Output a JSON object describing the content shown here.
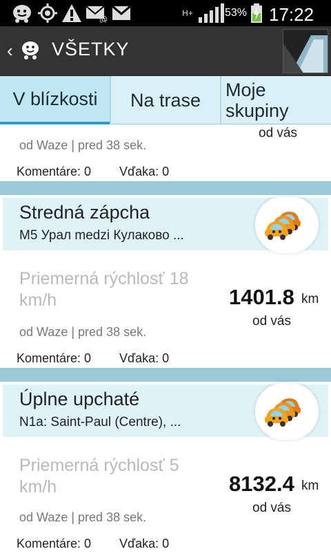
{
  "status_bar": {
    "battery_percent": "53%",
    "time": "17:22",
    "network": "H+",
    "icons": [
      "waze-notification-icon",
      "gps-icon",
      "warning-icon",
      "email-icon",
      "gmail-icon",
      "signal-icon",
      "battery-charging-icon"
    ]
  },
  "app_bar": {
    "title": "VŠETKY",
    "back_icon": "back-chevron-icon",
    "logo_icon": "waze-logo-icon"
  },
  "tabs": [
    {
      "label": "V blízkosti",
      "active": true
    },
    {
      "label": "Na trase",
      "active": false
    },
    {
      "label": "Moje skupiny",
      "active": false
    }
  ],
  "partial_card": {
    "distance_label": "od vás",
    "source": "od Waze | pred 38 sek.",
    "comments": "Komentáre: 0",
    "thanks": "Vďaka: 0"
  },
  "reports": [
    {
      "type": "Stredná zápcha",
      "street": "M5 Урал medzi Кулаково ...",
      "speed": "Priemerná rýchlosť 18 km/h",
      "distance": "1401.8",
      "unit": "km",
      "distance_label": "od vás",
      "source": "od Waze | pred 38 sek.",
      "comments": "Komentáre: 0",
      "thanks": "Vďaka: 0",
      "icon": "traffic-jam-icon"
    },
    {
      "type": "Úplne upchaté",
      "street": "N1a: Saint-Paul (Centre), ...",
      "speed": "Priemerná rýchlosť 5 km/h",
      "distance": "8132.4",
      "unit": "km",
      "distance_label": "od vás",
      "source": "od Waze | pred 38 sek.",
      "comments": "Komentáre: 0",
      "thanks": "Vďaka: 0",
      "icon": "traffic-jam-icon"
    }
  ],
  "colors": {
    "accent": "#2a9dc9",
    "tab_bg": "#d9f0f7",
    "separator": "#9cc9d9",
    "car_orange": "#f28c1e"
  }
}
